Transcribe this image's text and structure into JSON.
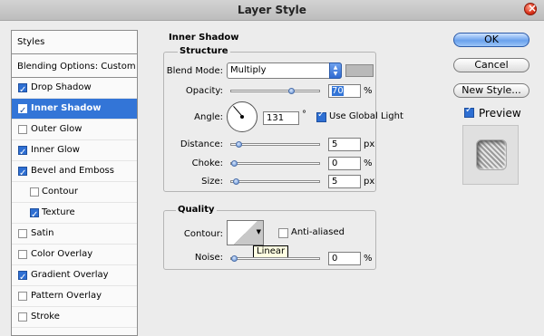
{
  "window": {
    "title": "Layer Style"
  },
  "sidebar": {
    "header": "Styles",
    "blending_options": "Blending Options: Custom",
    "items": [
      {
        "label": "Drop Shadow",
        "checked": true,
        "sub": false,
        "selected": false
      },
      {
        "label": "Inner Shadow",
        "checked": true,
        "sub": false,
        "selected": true
      },
      {
        "label": "Outer Glow",
        "checked": false,
        "sub": false,
        "selected": false
      },
      {
        "label": "Inner Glow",
        "checked": true,
        "sub": false,
        "selected": false
      },
      {
        "label": "Bevel and Emboss",
        "checked": true,
        "sub": false,
        "selected": false
      },
      {
        "label": "Contour",
        "checked": false,
        "sub": true,
        "selected": false
      },
      {
        "label": "Texture",
        "checked": true,
        "sub": true,
        "selected": false
      },
      {
        "label": "Satin",
        "checked": false,
        "sub": false,
        "selected": false
      },
      {
        "label": "Color Overlay",
        "checked": false,
        "sub": false,
        "selected": false
      },
      {
        "label": "Gradient Overlay",
        "checked": true,
        "sub": false,
        "selected": false
      },
      {
        "label": "Pattern Overlay",
        "checked": false,
        "sub": false,
        "selected": false
      },
      {
        "label": "Stroke",
        "checked": false,
        "sub": false,
        "selected": false
      }
    ]
  },
  "panel": {
    "title": "Inner Shadow",
    "structure": {
      "title": "Structure",
      "blend_mode_label": "Blend Mode:",
      "blend_mode_value": "Multiply",
      "opacity_label": "Opacity:",
      "opacity_value": "70",
      "opacity_level": 0.7,
      "percent": "%",
      "angle_label": "Angle:",
      "angle_value": "131",
      "degree": "°",
      "global_light_label": "Use Global Light",
      "global_light_checked": true,
      "distance_label": "Distance:",
      "distance_value": "5",
      "distance_level": 0.05,
      "px": "px",
      "choke_label": "Choke:",
      "choke_value": "0",
      "choke_level": 0,
      "size_label": "Size:",
      "size_value": "5",
      "size_level": 0.02
    },
    "quality": {
      "title": "Quality",
      "contour_label": "Contour:",
      "anti_aliased_label": "Anti-aliased",
      "anti_aliased_checked": false,
      "tooltip": "Linear",
      "noise_label": "Noise:",
      "noise_value": "0",
      "noise_level": 0
    }
  },
  "buttons": {
    "ok": "OK",
    "cancel": "Cancel",
    "new_style": "New Style...",
    "preview_label": "Preview",
    "preview_checked": true
  },
  "colors": {
    "accent": "#3375d7",
    "shadow_color": "#b9b9b9"
  }
}
